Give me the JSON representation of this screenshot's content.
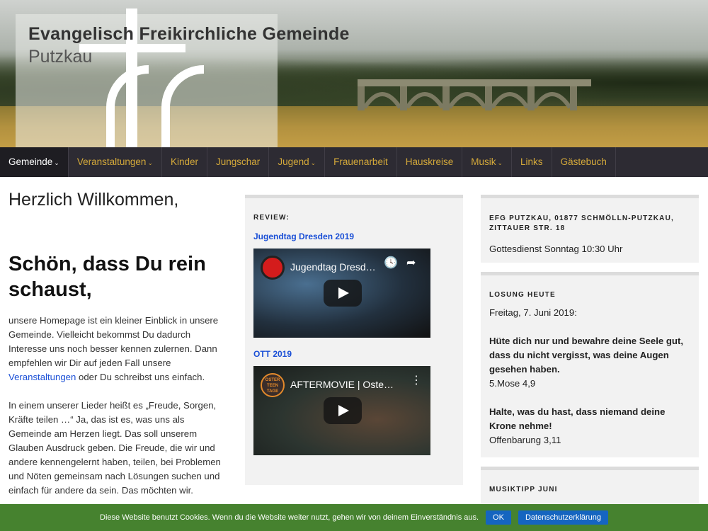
{
  "header": {
    "title_line1": "Evangelisch  Freikirchliche  Gemeinde",
    "title_line2": "Putzkau"
  },
  "nav": {
    "items": [
      {
        "label": "Gemeinde",
        "dropdown": true
      },
      {
        "label": "Veranstaltungen",
        "dropdown": true
      },
      {
        "label": "Kinder",
        "dropdown": false
      },
      {
        "label": "Jungschar",
        "dropdown": false
      },
      {
        "label": "Jugend",
        "dropdown": true
      },
      {
        "label": "Frauenarbeit",
        "dropdown": false
      },
      {
        "label": "Hauskreise",
        "dropdown": false
      },
      {
        "label": "Musik",
        "dropdown": true
      },
      {
        "label": "Links",
        "dropdown": false
      },
      {
        "label": "Gästebuch",
        "dropdown": false
      }
    ],
    "caret": "⌄"
  },
  "main": {
    "welcome": "Herzlich Willkommen,",
    "headline": "Schön, dass Du rein schaust,",
    "p1_before": "unsere Homepage ist ein kleiner Einblick in unsere Gemeinde. Vielleicht bekommst Du dadurch Interesse uns noch besser kennen zulernen. Dann empfehlen wir Dir auf jeden Fall unsere ",
    "p1_link": "Veranstaltungen",
    "p1_after": " oder Du schreibst uns einfach.",
    "p2": "In einem unserer Lieder heißt es „Freude, Sorgen, Kräfte teilen …“ Ja, das ist es, was uns als Gemeinde am Herzen liegt. Das soll unserem Glauben Ausdruck geben. Die Freude, die wir und andere kennengelernt haben, teilen, bei Problemen und Nöten gemeinsam nach Lösungen suchen und einfach für andere da sein. Das möchten wir."
  },
  "review": {
    "title": "REVIEW:",
    "videos": [
      {
        "link": "Jugendtag Dresden 2019",
        "title": "Jugendtag Dresd…"
      },
      {
        "link": "OTT 2019",
        "title": "AFTERMOVIE | Ostert…",
        "channel_text": "OSTER TEEN TAGE"
      }
    ],
    "icons": {
      "clock": "🕓",
      "share": "➦",
      "more": "⋮"
    }
  },
  "sidebar": {
    "contact_title": "EFG PUTZKAU, 01877 SCHMÖLLN-PUTZKAU, ZITTAUER STR. 18",
    "contact_text": "Gottesdienst Sonntag 10:30 Uhr",
    "losung_title": "LOSUNG HEUTE",
    "losung_date": "Freitag, 7. Juni 2019:",
    "verse1": "Hüte dich nur und bewahre deine Seele gut, dass du nicht vergisst, was deine Augen gesehen haben.",
    "ref1": "5.Mose 4,9",
    "verse2": "Halte, was du hast, dass niemand deine Krone nehme!",
    "ref2": "Offenbarung 3,11",
    "musik_title": "MUSIKTIPP JUNI"
  },
  "cookie": {
    "text": "Diese Website benutzt Cookies. Wenn du die Website weiter nutzt, gehen wir von deinem Einverständnis aus.",
    "ok": "OK",
    "privacy": "Datenschutzerklärung"
  }
}
